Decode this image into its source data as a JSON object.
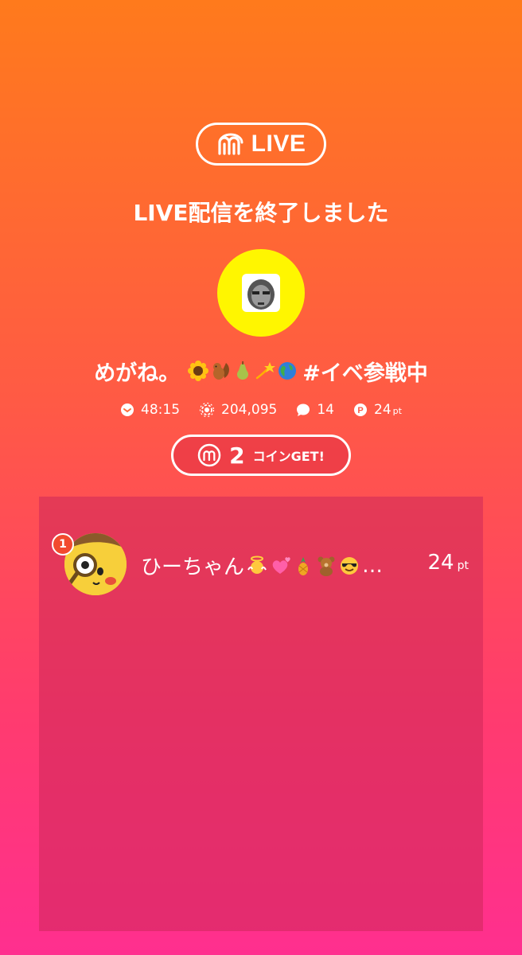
{
  "header": {
    "live_label": "LIVE",
    "end_message": "LIVE配信を終了しました"
  },
  "streamer": {
    "name": "めがね。",
    "name_emojis": [
      "sunflower",
      "chipmunk",
      "pear",
      "dizzy",
      "globe"
    ],
    "name_tail": "#イベ参戦中"
  },
  "stats": {
    "duration": "48:15",
    "views": "204,095",
    "comments": "14",
    "points": "24",
    "points_unit": "pt"
  },
  "coin": {
    "count": "2",
    "label": "コインGET!"
  },
  "ranking": [
    {
      "rank": "1",
      "name": "ひーちゃん",
      "name_emojis": [
        "angel",
        "hearts",
        "pineapple",
        "bear",
        "sunglasses"
      ],
      "ellipsis": "…",
      "points": "24",
      "unit": "pt"
    }
  ],
  "colors": {
    "gradient_top": "#ff7a1c",
    "gradient_bottom": "#ff2f8f",
    "avatar_bg": "#fff600",
    "rank_badge": "#f24a2e"
  }
}
